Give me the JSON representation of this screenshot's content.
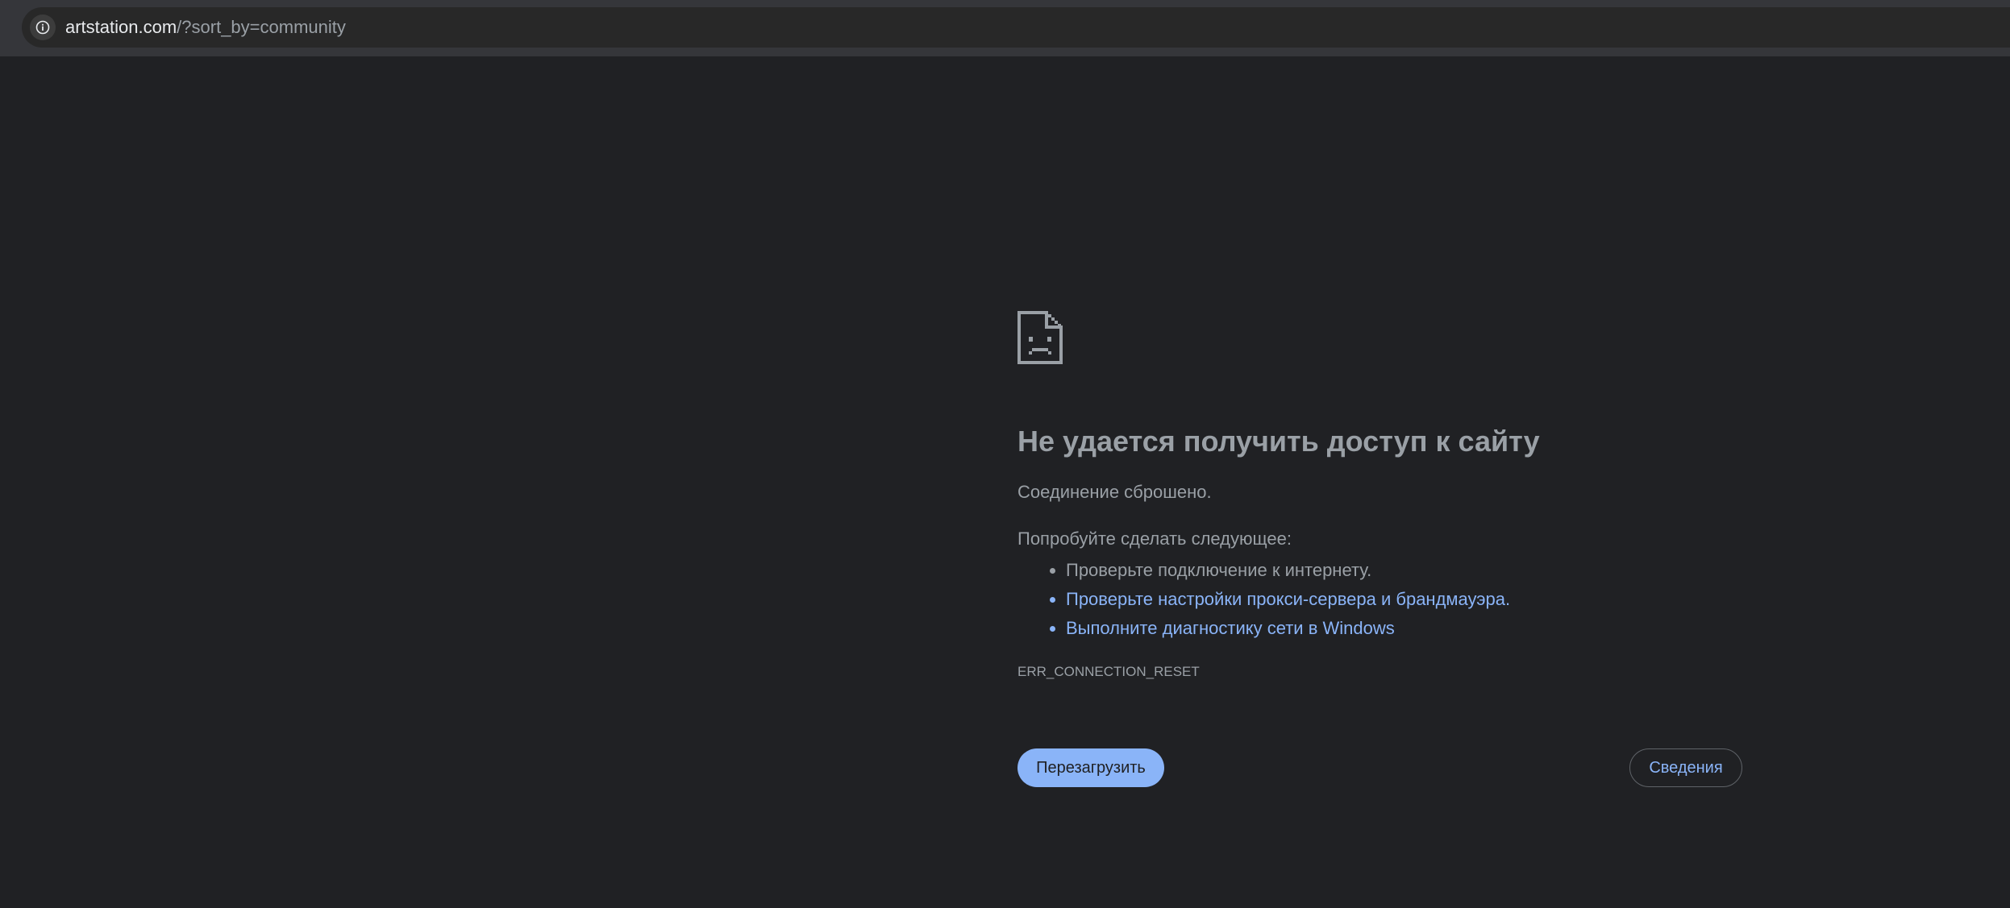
{
  "address_bar": {
    "host": "artstation.com",
    "path": "/?sort_by=community",
    "site_info_icon": "info-icon"
  },
  "error_page": {
    "icon": "sad-page-icon",
    "title": "Не удается получить доступ к сайту",
    "summary": "Соединение сброшено.",
    "try_label": "Попробуйте сделать следующее:",
    "suggestions": {
      "check_connection": "Проверьте подключение к интернету.",
      "check_proxy": "Проверьте настройки прокси-сервера и брандмауэра",
      "check_proxy_suffix": ".",
      "run_diagnostics": "Выполните диагностику сети в Windows"
    },
    "error_code": "ERR_CONNECTION_RESET",
    "reload_button": "Перезагрузить",
    "details_button": "Сведения"
  },
  "colors": {
    "background": "#202124",
    "text": "#9aa0a6",
    "link": "#8ab4f8",
    "primary_button": "#8ab4f8"
  }
}
